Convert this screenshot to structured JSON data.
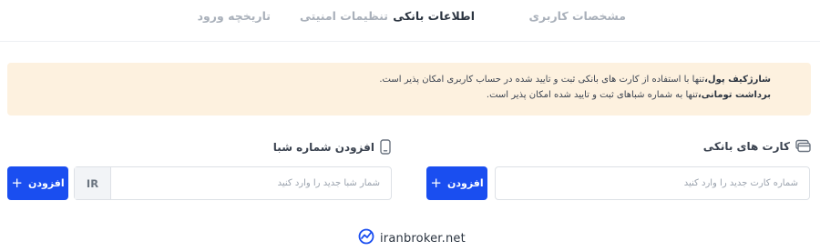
{
  "tabs": [
    {
      "label": "مشخصات کاربری",
      "active": false
    },
    {
      "label": "اطلاعات بانکی",
      "active": true
    },
    {
      "label": "تنظیمات امنیتی",
      "active": false
    },
    {
      "label": "تاریخچه ورود",
      "active": false
    }
  ],
  "notice": {
    "line1_bold": "شارژکیف پول،",
    "line1_text": "تنها با استفاده از کارت های بانکی ثبت و تایید شده در حساب کاربری امکان پذیر است.",
    "line2_bold": "برداشت تومانی،",
    "line2_text": "تنها به شماره شباهای ثبت و تایید شده امکان پذیر است.",
    "background": "#fdf1df"
  },
  "bank_cards": {
    "title": "کارت های بانکی",
    "icon": "bank-card-icon",
    "input_placeholder": "شماره کارت جدید را وارد کنید",
    "add_label": "افزودن"
  },
  "shaba": {
    "title": "افزودن شماره شبا",
    "icon": "phone-icon",
    "prefix": "IR",
    "input_placeholder": "شمار شبا جدید را وارد کنید",
    "add_label": "افزودن"
  },
  "watermark": {
    "text": "iranbroker.net",
    "icon": "iranbroker-logo-icon"
  },
  "colors": {
    "primary": "#1a4ef0",
    "active_tab": "#2b3440",
    "inactive_tab": "#a9b0ba"
  }
}
